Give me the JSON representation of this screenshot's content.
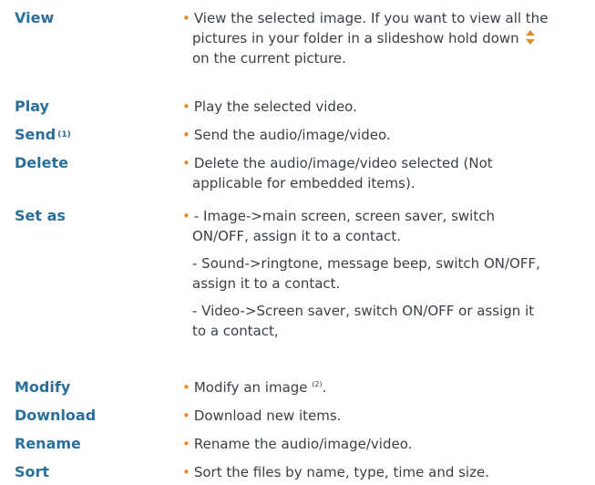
{
  "colors": {
    "term": "#2a6f9a",
    "bullet": "#e6892b",
    "text": "#3a3f45"
  },
  "rows": [
    {
      "term": "View",
      "lines": [
        "View the selected image. If you want to view all the",
        "pictures in your folder in a slideshow hold down",
        "on the current picture."
      ]
    },
    {
      "term": "Play",
      "lines": [
        "Play the selected video."
      ]
    },
    {
      "term": "Send",
      "term_note": "(1)",
      "lines": [
        "Send the audio/image/video."
      ]
    },
    {
      "term": "Delete",
      "lines": [
        "Delete the audio/image/video selected (Not",
        "applicable for embedded items)."
      ]
    },
    {
      "term": "Set as",
      "lines": [
        "- Image->main screen, screen saver, switch",
        "ON/OFF, assign it to a contact.",
        "- Sound->ringtone, message beep, switch ON/OFF,",
        "assign it to a contact.",
        "- Video->Screen saver, switch ON/OFF or assign it",
        "to a contact,"
      ]
    },
    {
      "term": "Modify",
      "lines": [
        "Modify an image",
        "(2)",
        "."
      ]
    },
    {
      "term": "Download",
      "lines": [
        "Download new items."
      ]
    },
    {
      "term": "Rename",
      "lines": [
        "Rename the audio/image/video."
      ]
    },
    {
      "term": "Sort",
      "lines": [
        "Sort the files by name, type, time and size."
      ]
    }
  ],
  "icons": {
    "navigation": "up-down-arrow-icon"
  },
  "bullet": "•"
}
